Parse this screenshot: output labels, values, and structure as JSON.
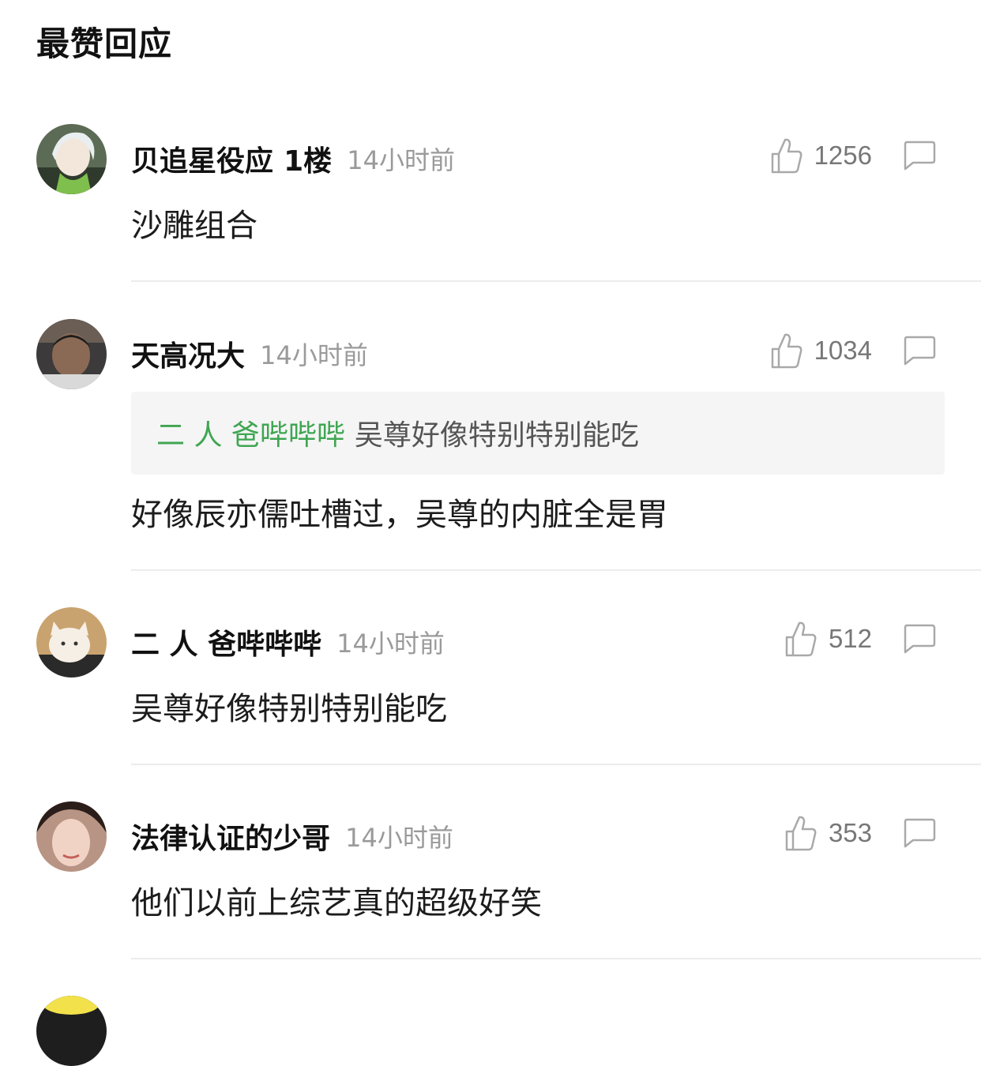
{
  "header": {
    "title": "最赞回应"
  },
  "comments": [
    {
      "username": "贝追星役应",
      "floor": "1楼",
      "time": "14小时前",
      "likes": "1256",
      "text": "沙雕组合"
    },
    {
      "username": "天高况大",
      "time": "14小时前",
      "likes": "1034",
      "quote": {
        "user": "二 人 爸哔哔哔",
        "text": "吴尊好像特别特别能吃"
      },
      "text": "好像辰亦儒吐槽过，吴尊的内脏全是胃"
    },
    {
      "username": "二 人 爸哔哔哔",
      "time": "14小时前",
      "likes": "512",
      "text": "吴尊好像特别特别能吃"
    },
    {
      "username": "法律认证的少哥",
      "time": "14小时前",
      "likes": "353",
      "text": "他们以前上综艺真的超级好笑"
    }
  ]
}
